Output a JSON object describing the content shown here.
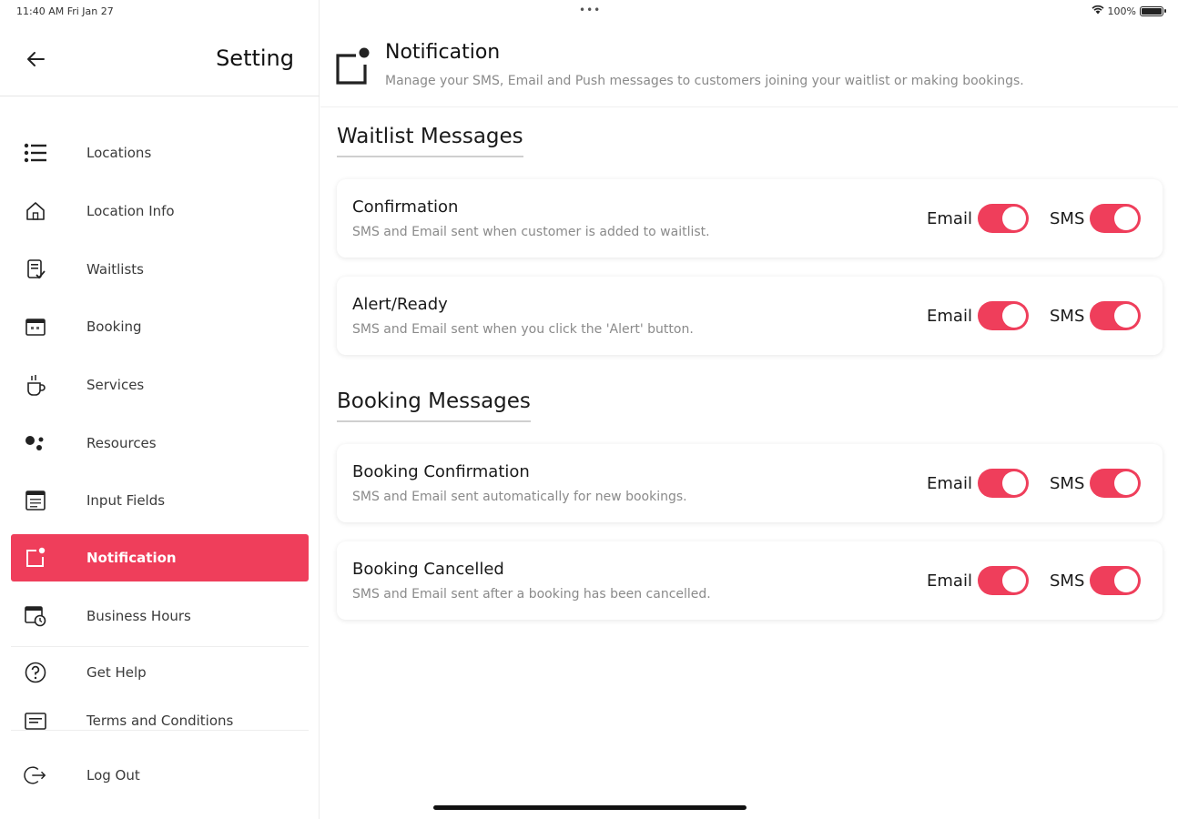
{
  "status_bar": {
    "time": "11:40 AM   Fri Jan 27",
    "dots": "•••",
    "battery_text": "100%"
  },
  "sidebar": {
    "back_icon": "arrow-left-icon",
    "title": "Setting",
    "items": [
      {
        "label": "Locations",
        "icon": "list-icon",
        "active": false
      },
      {
        "label": "Location Info",
        "icon": "home-icon",
        "active": false
      },
      {
        "label": "Waitlists",
        "icon": "clipboard-check-icon",
        "active": false
      },
      {
        "label": "Booking",
        "icon": "calendar-icon",
        "active": false
      },
      {
        "label": "Services",
        "icon": "coffee-cup-icon",
        "active": false
      },
      {
        "label": "Resources",
        "icon": "resources-icon",
        "active": false
      },
      {
        "label": "Input Fields",
        "icon": "form-icon",
        "active": false
      },
      {
        "label": "Notification",
        "icon": "notification-icon",
        "active": true
      },
      {
        "label": "Business Hours",
        "icon": "calendar-clock-icon",
        "active": false
      },
      {
        "label": "Get Help",
        "icon": "help-circle-icon",
        "active": false
      },
      {
        "label": "Terms and Conditions",
        "icon": "document-icon",
        "active": false
      },
      {
        "label": "Log Out",
        "icon": "logout-icon",
        "active": false
      }
    ]
  },
  "main": {
    "title": "Notification",
    "subtitle": "Manage your SMS, Email and Push messages to customers joining your waitlist or making bookings.",
    "sections": [
      {
        "title": "Waitlist Messages",
        "cards": [
          {
            "title": "Confirmation",
            "desc": "SMS and Email sent when customer is added to waitlist.",
            "email_label": "Email",
            "sms_label": "SMS",
            "email_on": true,
            "sms_on": true
          },
          {
            "title": "Alert/Ready",
            "desc": "SMS and Email sent when you click the 'Alert' button.",
            "email_label": "Email",
            "sms_label": "SMS",
            "email_on": true,
            "sms_on": true
          }
        ]
      },
      {
        "title": "Booking Messages",
        "cards": [
          {
            "title": "Booking Confirmation",
            "desc": "SMS and Email sent automatically for new bookings.",
            "email_label": "Email",
            "sms_label": "SMS",
            "email_on": true,
            "sms_on": true
          },
          {
            "title": "Booking Cancelled",
            "desc": "SMS and Email sent after a booking has been cancelled.",
            "email_label": "Email",
            "sms_label": "SMS",
            "email_on": true,
            "sms_on": true
          }
        ]
      }
    ]
  },
  "colors": {
    "accent": "#ef3e5b",
    "text": "#1a1a1a",
    "muted": "#8a8a8a"
  }
}
